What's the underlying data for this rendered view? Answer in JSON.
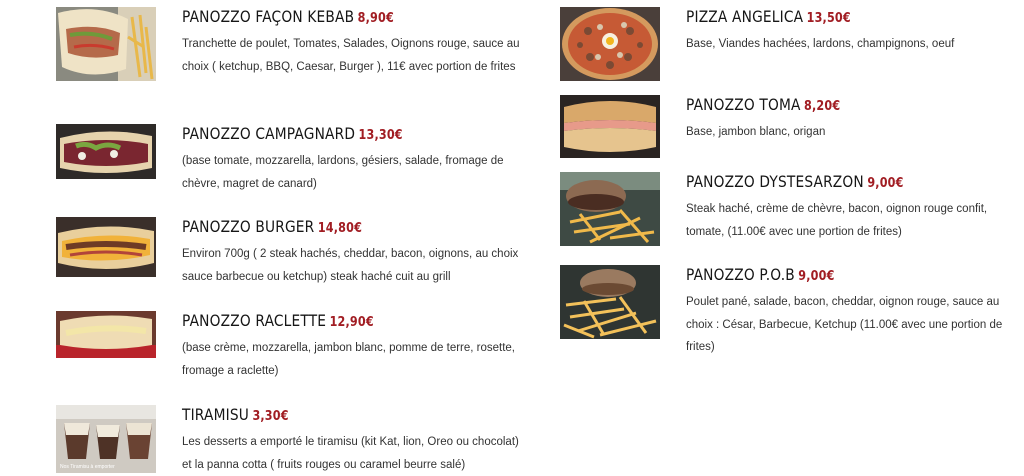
{
  "colors": {
    "price": "#a11d23",
    "title": "#161616",
    "text": "#333333"
  },
  "left_items": [
    {
      "name": "PANOZZO FAÇON KEBAB",
      "price": "8,90€",
      "description": "Tranchette de poulet, Tomates, Salades, Oignons rouge, sauce au choix ( ketchup, BBQ, Caesar, Burger ), 11€ avec portion de frites",
      "image": "kebab-sandwich-photo"
    },
    {
      "name": "PANOZZO CAMPAGNARD",
      "price": "13,30€",
      "description": "(base tomate, mozzarella, lardons, gésiers, salade, fromage de chèvre, magret de canard)",
      "image": "campagnard-sandwich-photo"
    },
    {
      "name": "PANOZZO BURGER",
      "price": "14,80€",
      "description": "Environ 700g ( 2 steak hachés, cheddar, bacon, oignons, au choix sauce barbecue ou ketchup) steak haché cuit au grill",
      "image": "burger-sandwich-photo"
    },
    {
      "name": "PANOZZO RACLETTE",
      "price": "12,90€",
      "description": "(base crème, mozzarella, jambon blanc, pomme de terre, rosette, fromage a raclette)",
      "image": "raclette-sandwich-photo"
    },
    {
      "name": "TIRAMISU",
      "price": "3,30€",
      "description": "Les desserts a emporté le tiramisu (kit Kat, lion, Oreo ou chocolat) et la panna cotta ( fruits rouges ou caramel beurre salé)",
      "image": "tiramisu-cups-photo",
      "image_caption": "Nos Tiramisu à emporter"
    }
  ],
  "right_items": [
    {
      "name": "PIZZA ANGELICA",
      "price": "13,50€",
      "description": "Base, Viandes hachées, lardons, champignons, oeuf",
      "image": "pizza-photo"
    },
    {
      "name": "PANOZZO TOMA",
      "price": "8,20€",
      "description": "Base, jambon blanc, origan",
      "image": "toma-sandwich-photo"
    },
    {
      "name": "PANOZZO DYSTESARZON",
      "price": "9,00€",
      "description": "Steak haché, crème de chèvre, bacon, oignon rouge confit, tomate, (11.00€ avec une portion de frites)",
      "image": "dystesarzon-with-fries-photo"
    },
    {
      "name": "PANOZZO P.O.B",
      "price": "9,00€",
      "description": "Poulet pané, salade, bacon, cheddar, oignon rouge, sauce au choix : César, Barbecue, Ketchup (11.00€ avec une portion de frites)",
      "image": "pob-with-fries-photo"
    }
  ]
}
